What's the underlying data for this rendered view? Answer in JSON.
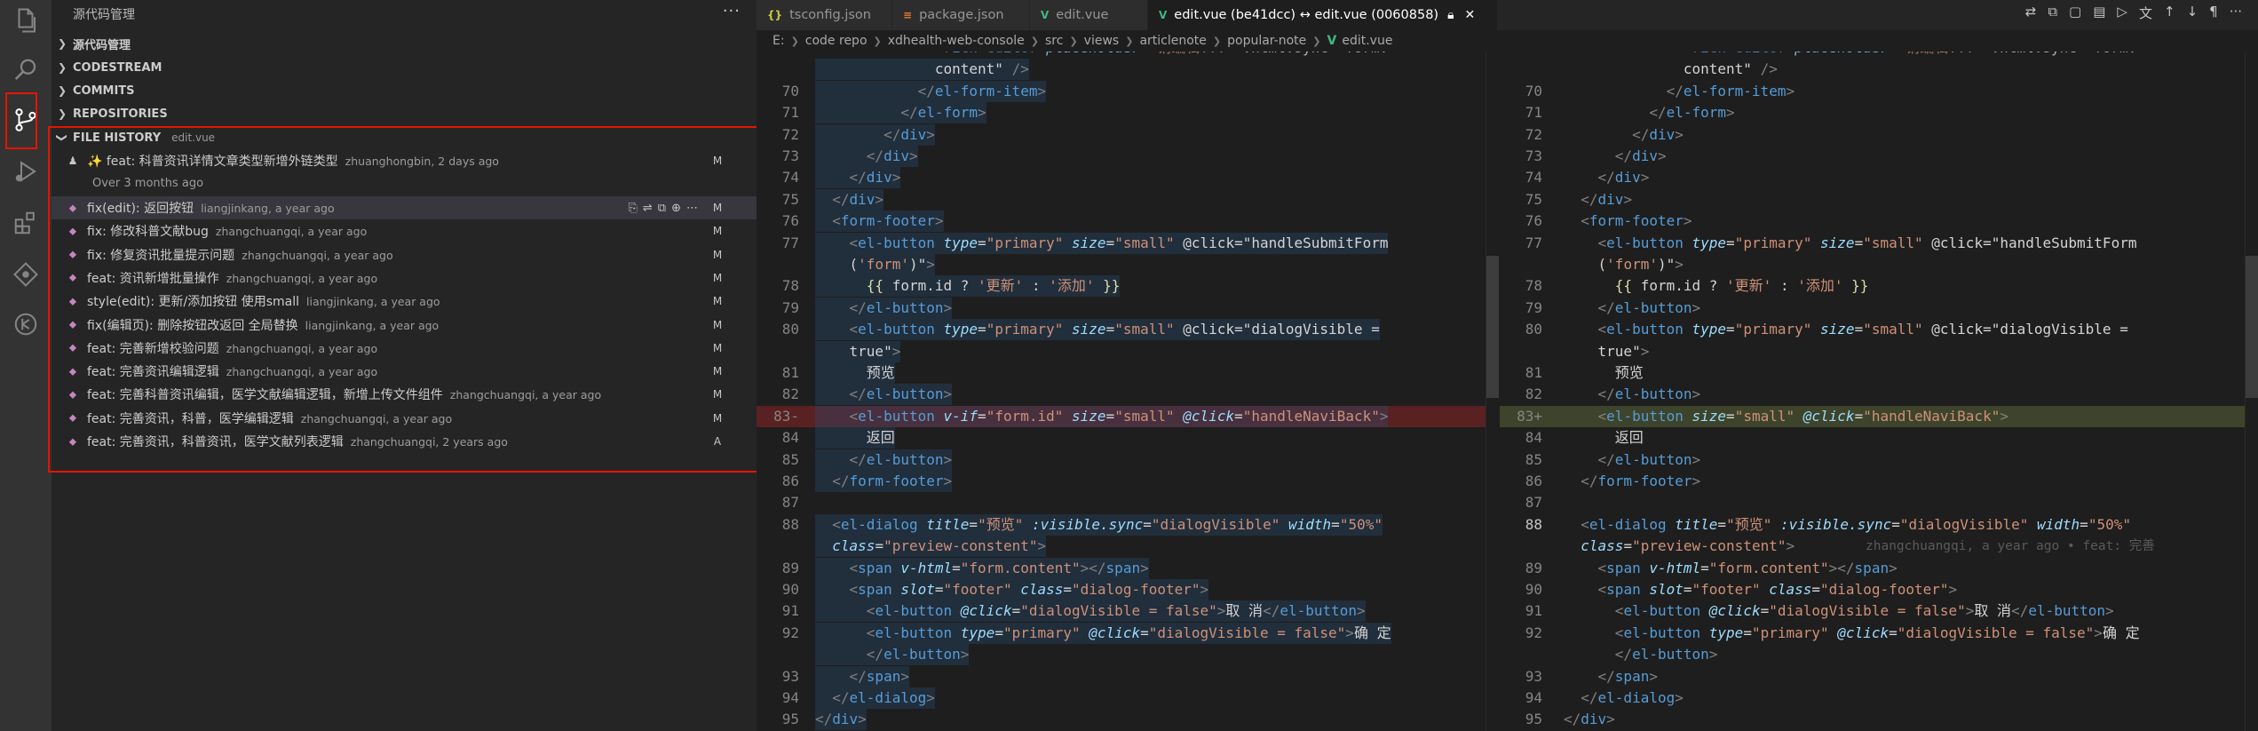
{
  "sidebar": {
    "title": "源代码管理",
    "sections": [
      {
        "name": "源代码管理",
        "expanded": false
      },
      {
        "name": "CODESTREAM",
        "expanded": false
      },
      {
        "name": "COMMITS",
        "expanded": false
      },
      {
        "name": "REPOSITORIES",
        "expanded": false
      }
    ],
    "file_history": {
      "title": "FILE HISTORY",
      "file": "edit.vue",
      "first": {
        "message": "✨ feat: 科普资讯详情文章类型新增外链类型",
        "meta": "zhuanghongbin, 2 days ago",
        "status": "M"
      },
      "group_label": "Over 3 months ago",
      "commits": [
        {
          "message": "fix(edit): 返回按钮",
          "meta": "liangjinkang, a year ago",
          "status": "M",
          "selected": true
        },
        {
          "message": "fix: 修改科普文献bug",
          "meta": "zhangchuangqi, a year ago",
          "status": "M"
        },
        {
          "message": "fix: 修复资讯批量提示问题",
          "meta": "zhangchuangqi, a year ago",
          "status": "M"
        },
        {
          "message": "feat: 资讯新增批量操作",
          "meta": "zhangchuangqi, a year ago",
          "status": "M"
        },
        {
          "message": "style(edit): 更新/添加按钮 使用small",
          "meta": "liangjinkang, a year ago",
          "status": "M"
        },
        {
          "message": "fix(编辑页): 删除按钮改返回 全局替换",
          "meta": "liangjinkang, a year ago",
          "status": "M"
        },
        {
          "message": "feat: 完善新增校验问题",
          "meta": "zhangchuangqi, a year ago",
          "status": "M"
        },
        {
          "message": "feat: 完善资讯编辑逻辑",
          "meta": "zhangchuangqi, a year ago",
          "status": "M"
        },
        {
          "message": "feat: 完善科普资讯编辑，医学文献编辑逻辑，新增上传文件组件",
          "meta": "zhangchuangqi, a year ago",
          "status": "M"
        },
        {
          "message": "feat: 完善资讯，科普，医学编辑逻辑",
          "meta": "zhangchuangqi, a year ago",
          "status": "M"
        },
        {
          "message": "feat: 完善资讯，科普资讯，医学文献列表逻辑",
          "meta": "zhangchuangqi, 2 years ago",
          "status": "A"
        }
      ]
    }
  },
  "tabs": [
    {
      "label": "tsconfig.json",
      "icon": "{}"
    },
    {
      "label": "package.json",
      "icon": "≡"
    },
    {
      "label": "edit.vue",
      "icon": "V"
    },
    {
      "label": "edit.vue (be41dcc) ↔ edit.vue (0060858)",
      "icon": "V",
      "active": true
    }
  ],
  "breadcrumb": [
    "E:",
    "code repo",
    "xdhealth-web-console",
    "src",
    "views",
    "articlenote",
    "popular-note",
    "edit.vue"
  ],
  "left_editor": {
    "partial_top": "              <rich-editor placeholder=\"请编辑...\" :html.sync=\"form.",
    "lines": [
      {
        "n": "",
        "code": "              content\" />"
      },
      {
        "n": "70",
        "code": "            </el-form-item>"
      },
      {
        "n": "71",
        "code": "          </el-form>"
      },
      {
        "n": "72",
        "code": "        </div>"
      },
      {
        "n": "73",
        "code": "      </div>"
      },
      {
        "n": "74",
        "code": "    </div>"
      },
      {
        "n": "75",
        "code": "  </div>"
      },
      {
        "n": "76",
        "code": "  <form-footer>"
      },
      {
        "n": "77",
        "code": "    <el-button type=\"primary\" size=\"small\" @click=\"handleSubmitForm"
      },
      {
        "n": "",
        "code": "    ('form')\">"
      },
      {
        "n": "78",
        "code": "      {{ form.id ? '更新' : '添加' }}"
      },
      {
        "n": "79",
        "code": "    </el-button>"
      },
      {
        "n": "80",
        "code": "    <el-button type=\"primary\" size=\"small\" @click=\"dialogVisible ="
      },
      {
        "n": "",
        "code": "    true\">"
      },
      {
        "n": "81",
        "code": "      预览"
      },
      {
        "n": "82",
        "code": "    </el-button>"
      },
      {
        "n": "83-",
        "code": "    <el-button v-if=\"form.id\" size=\"small\" @click=\"handleNaviBack\">",
        "diff": "del"
      },
      {
        "n": "84",
        "code": "      返回"
      },
      {
        "n": "85",
        "code": "    </el-button>"
      },
      {
        "n": "86",
        "code": "  </form-footer>"
      },
      {
        "n": "87",
        "code": ""
      },
      {
        "n": "88",
        "code": "  <el-dialog title=\"预览\" :visible.sync=\"dialogVisible\" width=\"50%\""
      },
      {
        "n": "",
        "code": "  class=\"preview-constent\">"
      },
      {
        "n": "89",
        "code": "    <span v-html=\"form.content\"></span>"
      },
      {
        "n": "90",
        "code": "    <span slot=\"footer\" class=\"dialog-footer\">"
      },
      {
        "n": "91",
        "code": "      <el-button @click=\"dialogVisible = false\">取 消</el-button>"
      },
      {
        "n": "92",
        "code": "      <el-button type=\"primary\" @click=\"dialogVisible = false\">确 定"
      },
      {
        "n": "",
        "code": "      </el-button>"
      },
      {
        "n": "93",
        "code": "    </span>"
      },
      {
        "n": "94",
        "code": "  </el-dialog>"
      },
      {
        "n": "95",
        "code": "</div>"
      }
    ]
  },
  "right_editor": {
    "partial_top": "              <rich-editor placeholder=\"请编辑...\" :html.sync=\"form.",
    "lines": [
      {
        "n": "",
        "code": "              content\" />"
      },
      {
        "n": "70",
        "code": "            </el-form-item>"
      },
      {
        "n": "71",
        "code": "          </el-form>"
      },
      {
        "n": "72",
        "code": "        </div>"
      },
      {
        "n": "73",
        "code": "      </div>"
      },
      {
        "n": "74",
        "code": "    </div>"
      },
      {
        "n": "75",
        "code": "  </div>"
      },
      {
        "n": "76",
        "code": "  <form-footer>"
      },
      {
        "n": "77",
        "code": "    <el-button type=\"primary\" size=\"small\" @click=\"handleSubmitForm"
      },
      {
        "n": "",
        "code": "    ('form')\">"
      },
      {
        "n": "78",
        "code": "      {{ form.id ? '更新' : '添加' }}"
      },
      {
        "n": "79",
        "code": "    </el-button>"
      },
      {
        "n": "80",
        "code": "    <el-button type=\"primary\" size=\"small\" @click=\"dialogVisible ="
      },
      {
        "n": "",
        "code": "    true\">"
      },
      {
        "n": "81",
        "code": "      预览"
      },
      {
        "n": "82",
        "code": "    </el-button>"
      },
      {
        "n": "83+",
        "code": "    <el-button size=\"small\" @click=\"handleNaviBack\">",
        "diff": "ins"
      },
      {
        "n": "84",
        "code": "      返回"
      },
      {
        "n": "85",
        "code": "    </el-button>"
      },
      {
        "n": "86",
        "code": "  </form-footer>"
      },
      {
        "n": "87",
        "code": ""
      },
      {
        "n": "88",
        "code": "  <el-dialog title=\"预览\" :visible.sync=\"dialogVisible\" width=\"50%\"",
        "current": true
      },
      {
        "n": "",
        "code": "  class=\"preview-constent\">",
        "blame": "zhangchuangqi, a year ago • feat: 完善"
      },
      {
        "n": "89",
        "code": "    <span v-html=\"form.content\"></span>"
      },
      {
        "n": "90",
        "code": "    <span slot=\"footer\" class=\"dialog-footer\">"
      },
      {
        "n": "91",
        "code": "      <el-button @click=\"dialogVisible = false\">取 消</el-button>"
      },
      {
        "n": "92",
        "code": "      <el-button type=\"primary\" @click=\"dialogVisible = false\">确 定"
      },
      {
        "n": "",
        "code": "      </el-button>"
      },
      {
        "n": "93",
        "code": "    </span>"
      },
      {
        "n": "94",
        "code": "  </el-dialog>"
      },
      {
        "n": "95",
        "code": "</div>"
      }
    ]
  }
}
